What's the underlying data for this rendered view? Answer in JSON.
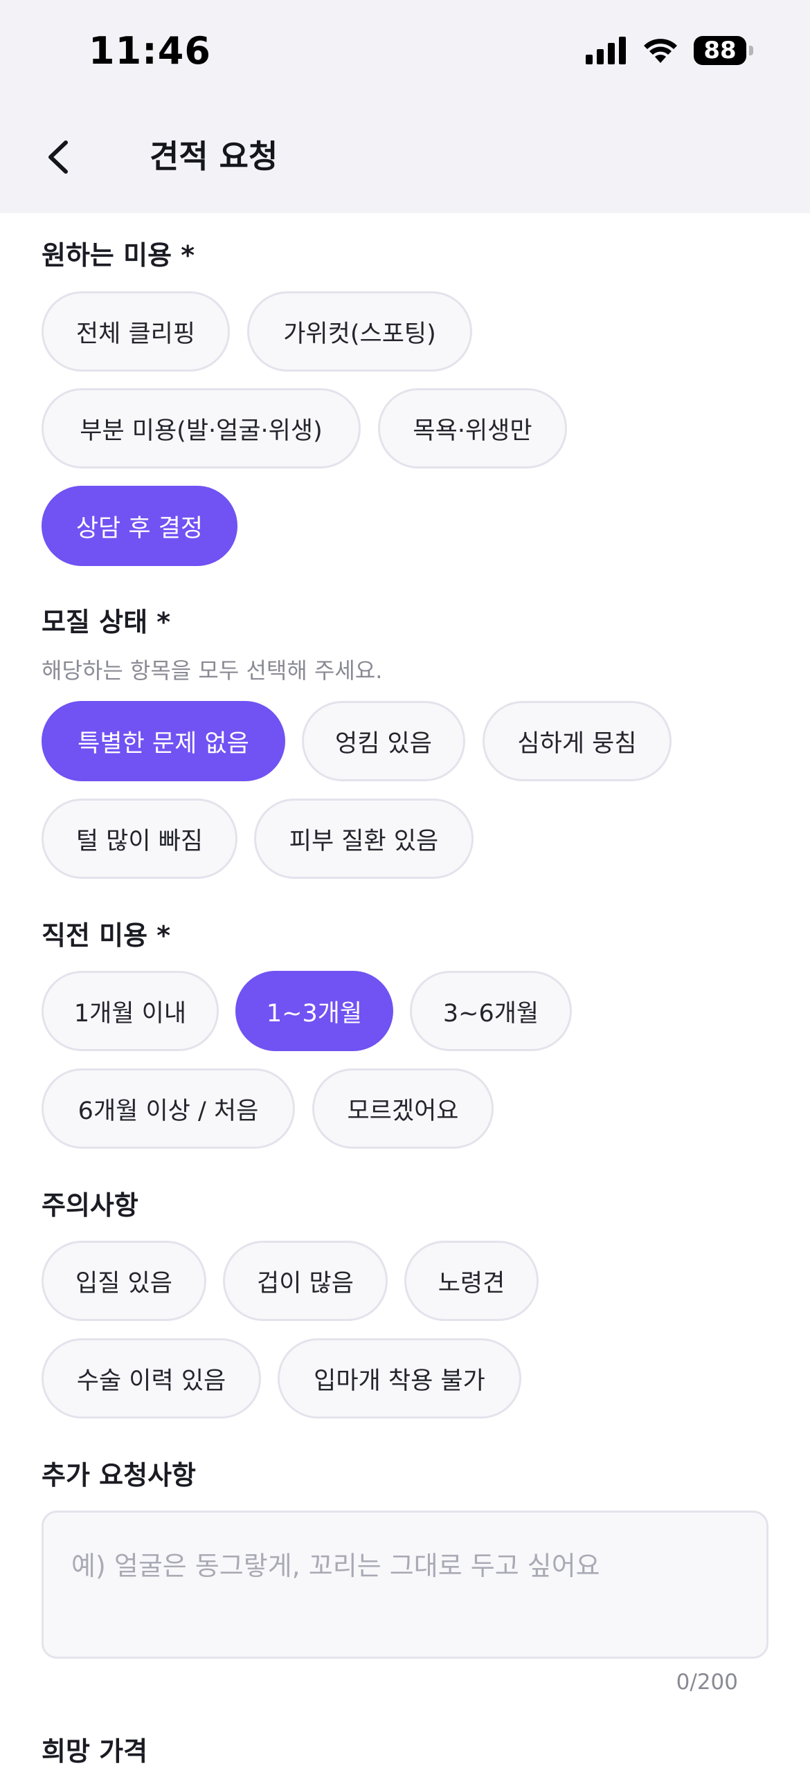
{
  "status_bar": {
    "time": "11:46",
    "battery": "88"
  },
  "nav": {
    "title": "견적 요청"
  },
  "sections": {
    "service": {
      "title": "원하는 미용 *",
      "options": [
        "전체 클리핑",
        "가위컷(스포팅)",
        "부분 미용(발·얼굴·위생)",
        "목욕·위생만",
        "상담 후 결정"
      ],
      "selected": "상담 후 결정"
    },
    "coat": {
      "title": "모질 상태 *",
      "subtitle": "해당하는 항목을 모두 선택해 주세요.",
      "options": [
        "특별한 문제 없음",
        "엉킴 있음",
        "심하게 뭉침",
        "털 많이 빠짐",
        "피부 질환 있음"
      ],
      "selected": "특별한 문제 없음"
    },
    "last_groom": {
      "title": "직전 미용 *",
      "options": [
        "1개월 이내",
        "1~3개월",
        "3~6개월",
        "6개월 이상 / 처음",
        "모르겠어요"
      ],
      "selected": "1~3개월"
    },
    "cautions": {
      "title": "주의사항",
      "options": [
        "입질 있음",
        "겁이 많음",
        "노령견",
        "수술 이력 있음",
        "입마개 착용 불가"
      ]
    },
    "extra": {
      "title": "추가 요청사항",
      "placeholder": "예) 얼굴은 동그랗게, 꼬리는 그대로 두고 싶어요",
      "counter": "0/200"
    },
    "price": {
      "title": "희망 가격"
    }
  },
  "colors": {
    "accent": "#7152f3",
    "chip_bg": "#f8f8fb",
    "chip_border": "#e3e3ec",
    "header_bg": "#f2f2f7"
  }
}
